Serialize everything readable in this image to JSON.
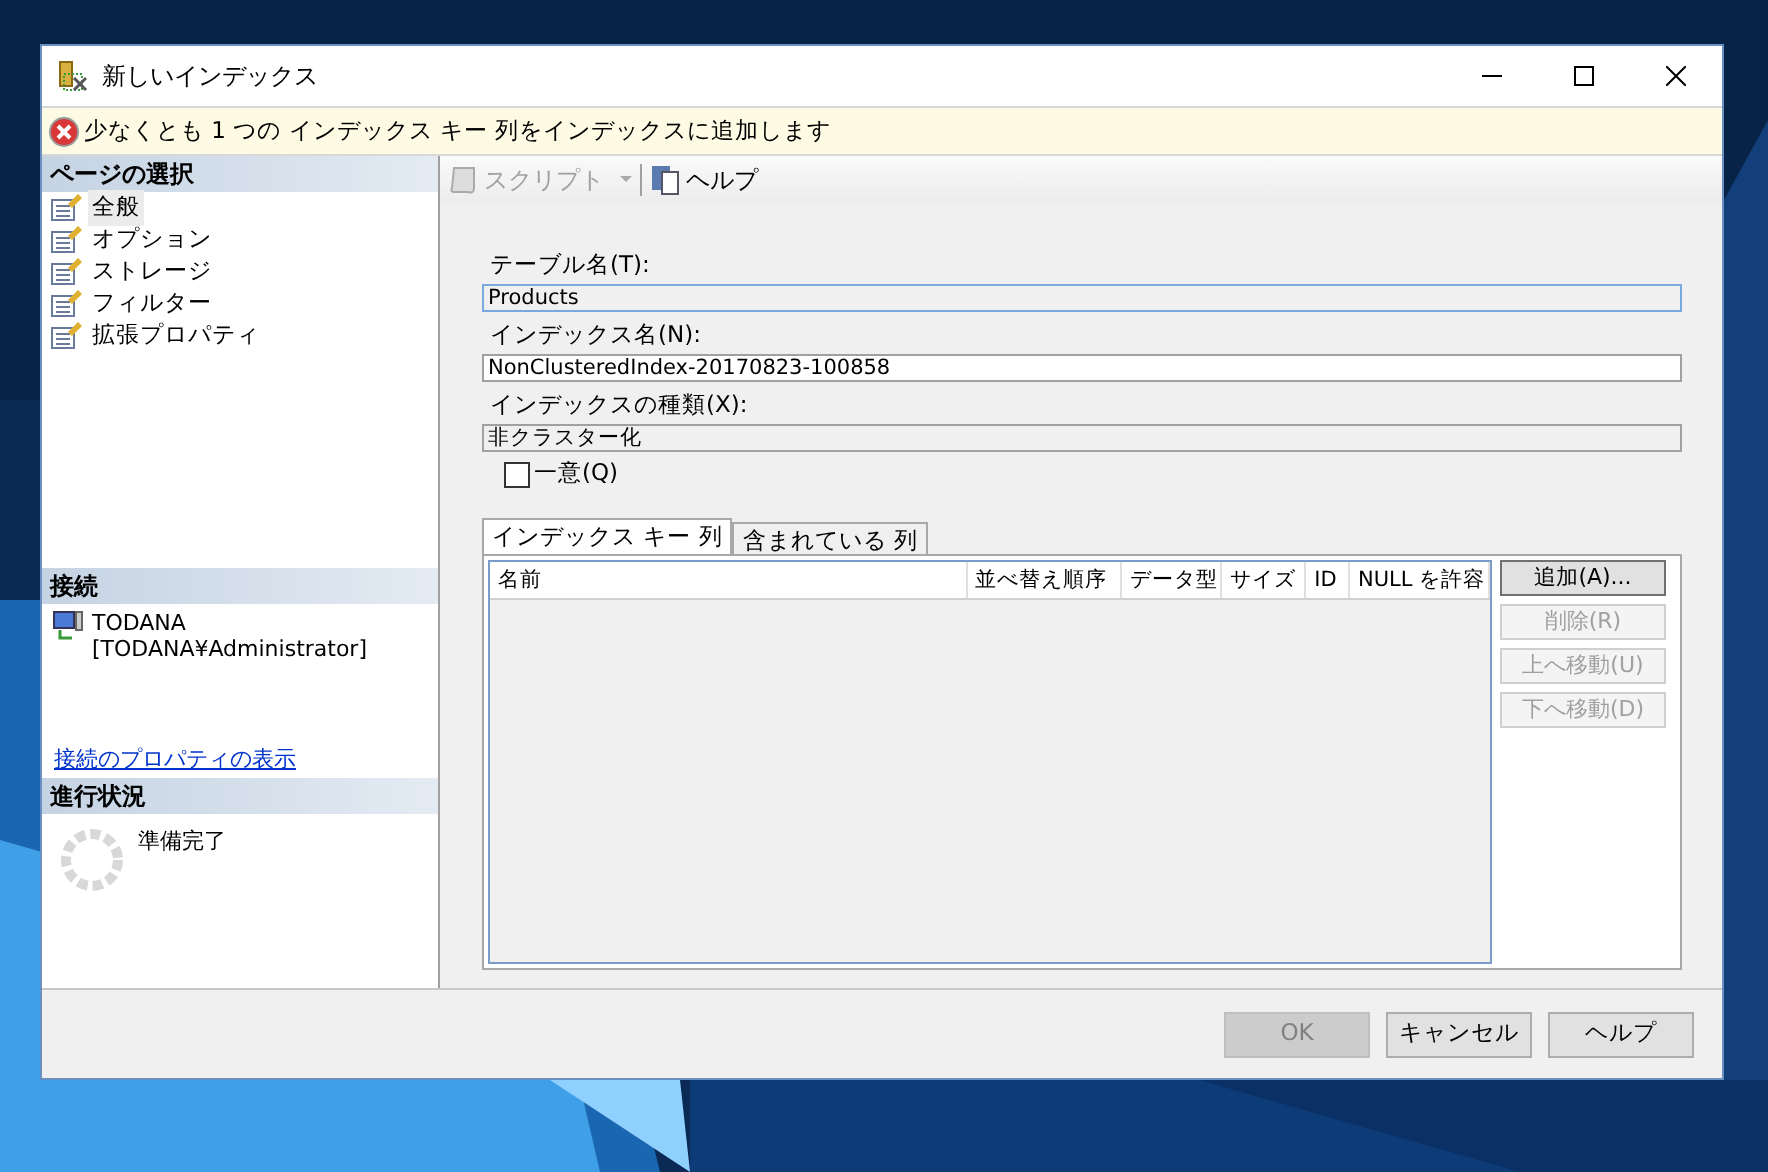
{
  "window": {
    "title": "新しいインデックス"
  },
  "error_bar": {
    "message": "少なくとも 1 つの インデックス キー 列をインデックスに追加します"
  },
  "page_select": {
    "title": "ページの選択",
    "items": [
      {
        "label": "全般",
        "selected": true
      },
      {
        "label": "オプション",
        "selected": false
      },
      {
        "label": "ストレージ",
        "selected": false
      },
      {
        "label": "フィルター",
        "selected": false
      },
      {
        "label": "拡張プロパティ",
        "selected": false
      }
    ]
  },
  "connection": {
    "title": "接続",
    "server": "TODANA",
    "user": "[TODANA¥Administrator]",
    "link": "接続のプロパティの表示"
  },
  "progress": {
    "title": "進行状況",
    "status": "準備完了"
  },
  "toolbar": [
    {
      "label": "スクリプト",
      "disabled": true,
      "kind": "script"
    },
    {
      "label": "ヘルプ",
      "disabled": false,
      "kind": "help"
    }
  ],
  "form": {
    "fields": [
      {
        "label": "テーブル名(T):",
        "value": "Products",
        "disabled": true
      },
      {
        "label": "インデックス名(N):",
        "value": "NonClusteredIndex-20170823-100858",
        "disabled": false
      },
      {
        "label": "インデックスの種類(X):",
        "value": "非クラスター化",
        "disabled": true
      }
    ],
    "unique": {
      "label": "一意(Q)",
      "checked": false
    }
  },
  "tabs": [
    {
      "label": "インデックス キー 列",
      "selected": true
    },
    {
      "label": "含まれている 列",
      "selected": false
    }
  ],
  "table": {
    "columns": [
      "名前",
      "並べ替え順序",
      "データ型",
      "サイズ",
      "ID",
      "NULL を許容"
    ]
  },
  "side_buttons": [
    {
      "label": "追加(A)...",
      "disabled": false
    },
    {
      "label": "削除(R)",
      "disabled": true
    },
    {
      "label": "上へ移動(U)",
      "disabled": true
    },
    {
      "label": "下へ移動(D)",
      "disabled": true
    }
  ],
  "footer_buttons": [
    {
      "label": "OK",
      "disabled": true
    },
    {
      "label": "キャンセル",
      "disabled": false
    },
    {
      "label": "ヘルプ",
      "disabled": false
    }
  ]
}
